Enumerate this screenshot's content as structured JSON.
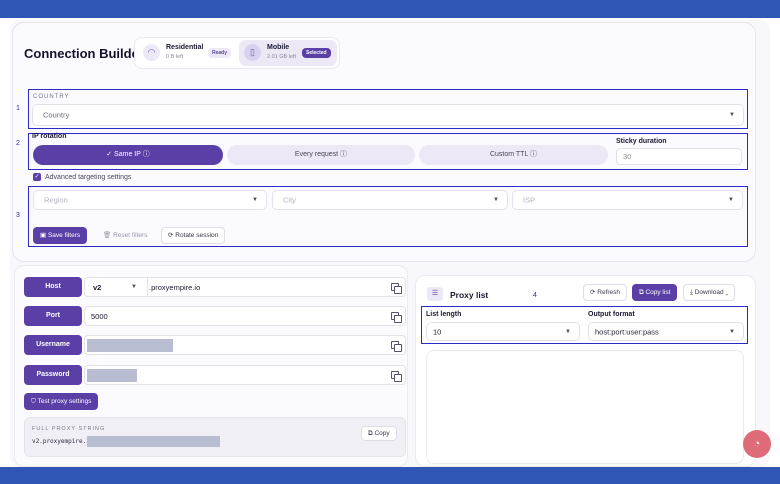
{
  "header": {
    "title": "Connection Builder"
  },
  "plans": [
    {
      "name": "Residential",
      "left": "0 B left",
      "status": "Ready",
      "icon": "wifi-icon"
    },
    {
      "name": "Mobile",
      "left": "2.01 GB left",
      "status": "Selected",
      "icon": "phone-icon"
    }
  ],
  "annotations": [
    "1",
    "2",
    "3",
    "4"
  ],
  "country": {
    "label": "COUNTRY",
    "value": "Country"
  },
  "rotation": {
    "label": "IP rotation",
    "options": [
      "✓ Same IP ⓘ",
      "Every request ⓘ",
      "Custom TTL ⓘ"
    ],
    "selected_index": 0,
    "sticky_label": "Sticky duration",
    "sticky_value": "30"
  },
  "advanced": {
    "label": "Advanced targeting settings",
    "checked": true
  },
  "targeting": {
    "region": "Region",
    "city": "City",
    "isp": "ISP",
    "save": "Save filters",
    "reset": "Reset filters",
    "rotate": "Rotate session"
  },
  "connection": {
    "host_label": "Host",
    "host_version": "v2",
    "host_domain": ".proxyempire.io",
    "port_label": "Port",
    "port_value": "5000",
    "username_label": "Username",
    "password_label": "Password",
    "test_button": "Test proxy settings",
    "string_label": "FULL PROXY STRING",
    "string_prefix": "v2.proxyempire.io",
    "copy_button": "Copy"
  },
  "proxy_list": {
    "title": "Proxy list",
    "refresh": "Refresh",
    "copy_list": "Copy list",
    "download": "Download",
    "length_label": "List length",
    "length_value": "10",
    "format_label": "Output format",
    "format_value": "host:port:user:pass"
  },
  "colors": {
    "accent": "#5a3fa6",
    "annotation": "#2b2cc4",
    "bar": "#2f55b5"
  }
}
